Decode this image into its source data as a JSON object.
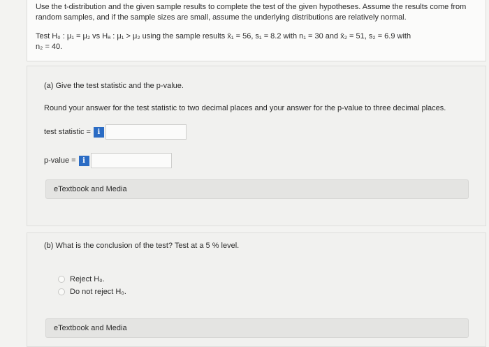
{
  "intro": {
    "text": "Use the t-distribution and the given sample results to complete the test of the given hypotheses. Assume the results come from random samples, and if the sample sizes are small, assume the underlying distributions are relatively normal.",
    "hypothesis_line1": "Test H₀ : μ₁ = μ₂ vs Hₐ : μ₁ > μ₂ using the sample results x̄₁ = 56, s₁ = 8.2 with n₁ = 30 and x̄₂ = 51, s₂ = 6.9 with",
    "hypothesis_line2": "n₂ = 40."
  },
  "part_a": {
    "title": "(a) Give the test statistic and the p-value.",
    "instruction": "Round your answer for the test statistic to two decimal places and your answer for the p-value to three decimal places.",
    "test_statistic_label": "test statistic =",
    "test_statistic_value": "",
    "p_value_label": "p-value =",
    "p_value_value": "",
    "info_icon": "i",
    "etextbook_label": "eTextbook and Media"
  },
  "part_b": {
    "title": "(b) What is the conclusion of the test? Test at a 5 % level.",
    "options": [
      "Reject H₀.",
      "Do not reject H₀."
    ],
    "etextbook_label": "eTextbook and Media"
  },
  "colors": {
    "info_button": "#2b6cc4"
  }
}
